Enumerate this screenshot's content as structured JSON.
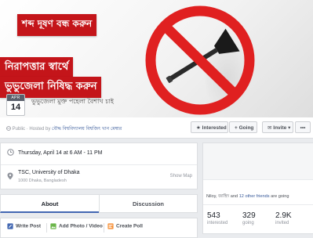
{
  "cover": {
    "banner_top": "শব্দ দূষণ বন্ধ করুন",
    "banner_mid": "নিরাপত্তার স্বার্থে",
    "banner_bottom": "ভুভুজেলা নিষিদ্ধ করুন",
    "caption": "ভুভুজেলা মুক্ত পহেলা বৈশাখ চাই",
    "date_month": "APR",
    "date_day": "14",
    "colors": {
      "banner": "#c4151a",
      "sign": "#e02020"
    }
  },
  "actionbar": {
    "privacy": "Public · Hosted by",
    "host": "বৌদ্ধ বিশ্ববিদ্যালয় বিশ্বজিৎ খান মেম্বার",
    "interested_label": "Interested",
    "going_label": "Going",
    "invite_label": "Invite",
    "more_label": "•••"
  },
  "event": {
    "datetime": "Thursday, April 14 at 6 AM - 11 PM",
    "location_name": "TSC, University of Dhaka",
    "location_address": "1000 Dhaka, Bangladesh",
    "show_map": "Show Map"
  },
  "tabs": [
    {
      "label": "About",
      "active": true
    },
    {
      "label": "Discussion",
      "active": false
    }
  ],
  "composer": {
    "write_post": "Write Post",
    "add_photo": "Add Photo / Video",
    "create_poll": "Create Poll"
  },
  "sidebar": {
    "friends_prefix": "Niloy, জাহিদ",
    "friends_middle": " and ",
    "friends_link": "12 other friends",
    "friends_suffix": " are going",
    "stats": [
      {
        "value": "543",
        "label": "interested"
      },
      {
        "value": "329",
        "label": "going"
      },
      {
        "value": "2.9K",
        "label": "invited"
      }
    ]
  }
}
